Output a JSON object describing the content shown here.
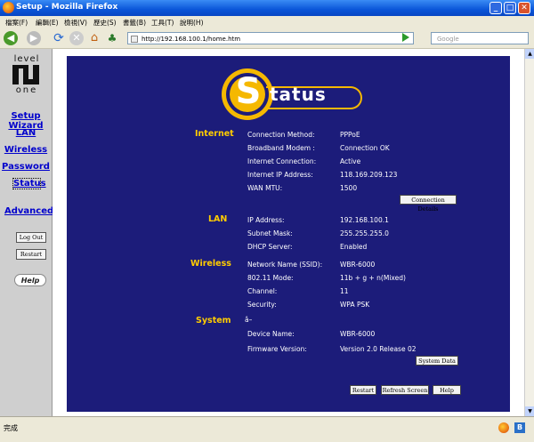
{
  "window": {
    "title": "Setup - Mozilla Firefox"
  },
  "menu": [
    "檔案(F)",
    "編輯(E)",
    "檢視(V)",
    "歷史(S)",
    "書籤(B)",
    "工具(T)",
    "說明(H)"
  ],
  "navbar": {
    "url": "http://192.168.100.1/home.htm",
    "search_placeholder": "Google"
  },
  "sidebar": {
    "logo_top": "level",
    "logo_bottom": "one",
    "items": [
      "Setup Wizard",
      "LAN",
      "Wireless",
      "Password",
      "Status",
      "Advanced"
    ],
    "logout_label": "Log Out",
    "restart_label": "Restart",
    "help_label": "Help"
  },
  "header": {
    "letter": "S",
    "rest": "tatus"
  },
  "internet": {
    "title": "Internet",
    "rows": [
      {
        "label": "Connection Method:",
        "value": "PPPoE"
      },
      {
        "label": "Broadband Modem :",
        "value": "Connection OK"
      },
      {
        "label": "Internet Connection:",
        "value": "Active"
      },
      {
        "label": "Internet IP Address:",
        "value": "118.169.209.123"
      },
      {
        "label": "WAN MTU:",
        "value": "1500"
      }
    ],
    "details_button": "Connection Details"
  },
  "lan": {
    "title": "LAN",
    "rows": [
      {
        "label": "IP Address:",
        "value": "192.168.100.1"
      },
      {
        "label": "Subnet Mask:",
        "value": "255.255.255.0"
      },
      {
        "label": "DHCP Server:",
        "value": "Enabled"
      }
    ]
  },
  "wireless": {
    "title": "Wireless",
    "rows": [
      {
        "label": "Network Name (SSID):",
        "value": "WBR-6000"
      },
      {
        "label": "802.11 Mode:",
        "value": "11b + g + n(Mixed)"
      },
      {
        "label": "Channel:",
        "value": "11"
      },
      {
        "label": "Security:",
        "value": "WPA PSK"
      }
    ]
  },
  "system": {
    "title": "System",
    "garbled": "â–",
    "rows": [
      {
        "label": "Device Name:",
        "value": "WBR-6000"
      },
      {
        "label": "Firmware Version:",
        "value": "Version 2.0 Release 02"
      }
    ],
    "data_button": "System Data"
  },
  "footer_buttons": {
    "restart": "Restart",
    "refresh": "Refresh Screen",
    "help": "Help"
  },
  "statusbar": {
    "text": "完成"
  },
  "colors": {
    "panel": "#1c1c7a",
    "section": "#ffcc00",
    "link": "#0000cc",
    "logo_ring": "#f5b800"
  }
}
